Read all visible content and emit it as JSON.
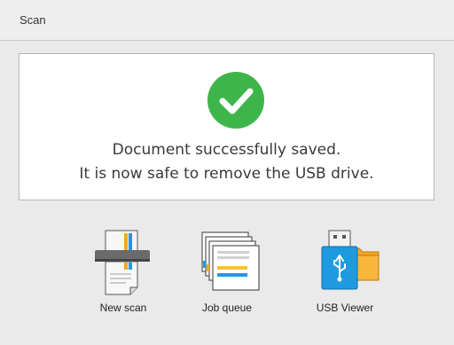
{
  "header": {
    "title": "Scan"
  },
  "message": {
    "icon": "checkmark-success-icon",
    "line1": "Document successfully saved.",
    "line2": "It is now safe to remove the USB drive."
  },
  "actions": [
    {
      "label": "New scan",
      "icon": "scanner-icon"
    },
    {
      "label": "Job queue",
      "icon": "job-queue-icon"
    },
    {
      "label": "USB Viewer",
      "icon": "usb-folder-icon"
    }
  ],
  "colors": {
    "success": "#3db54a",
    "accent_blue": "#1e9be0",
    "accent_orange": "#f5a623",
    "accent_yellow": "#f9c12e"
  }
}
